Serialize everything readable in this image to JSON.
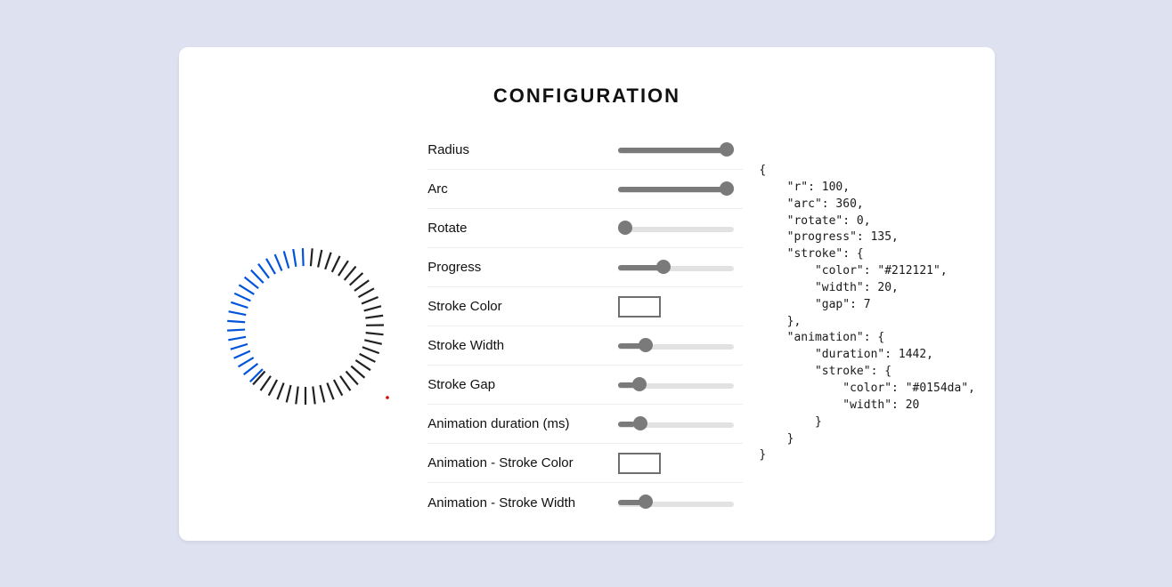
{
  "title": "CONFIGURATION",
  "controls": {
    "radius": {
      "label": "Radius",
      "value": 100,
      "min": 0,
      "max": 100
    },
    "arc": {
      "label": "Arc",
      "value": 360,
      "min": 0,
      "max": 360
    },
    "rotate": {
      "label": "Rotate",
      "value": 0,
      "min": 0,
      "max": 360
    },
    "progress": {
      "label": "Progress",
      "value": 135,
      "min": 0,
      "max": 360
    },
    "strokeColor": {
      "label": "Stroke Color",
      "value": "#212121"
    },
    "strokeWidth": {
      "label": "Stroke Width",
      "value": 20,
      "min": 0,
      "max": 100
    },
    "strokeGap": {
      "label": "Stroke Gap",
      "value": 7,
      "min": 0,
      "max": 50
    },
    "animDur": {
      "label": "Animation duration (ms)",
      "value": 1442,
      "min": 0,
      "max": 10000
    },
    "animColor": {
      "label": "Animation - Stroke Color",
      "value": "#0154da"
    },
    "animWidth": {
      "label": "Animation - Stroke Width",
      "value": 20,
      "min": 0,
      "max": 100
    }
  },
  "json_output": "{\n    \"r\": 100,\n    \"arc\": 360,\n    \"rotate\": 0,\n    \"progress\": 135,\n    \"stroke\": {\n        \"color\": \"#212121\",\n        \"width\": 20,\n        \"gap\": 7\n    },\n    \"animation\": {\n        \"duration\": 1442,\n        \"stroke\": {\n            \"color\": \"#0154da\",\n            \"width\": 20\n        }\n    }\n}"
}
